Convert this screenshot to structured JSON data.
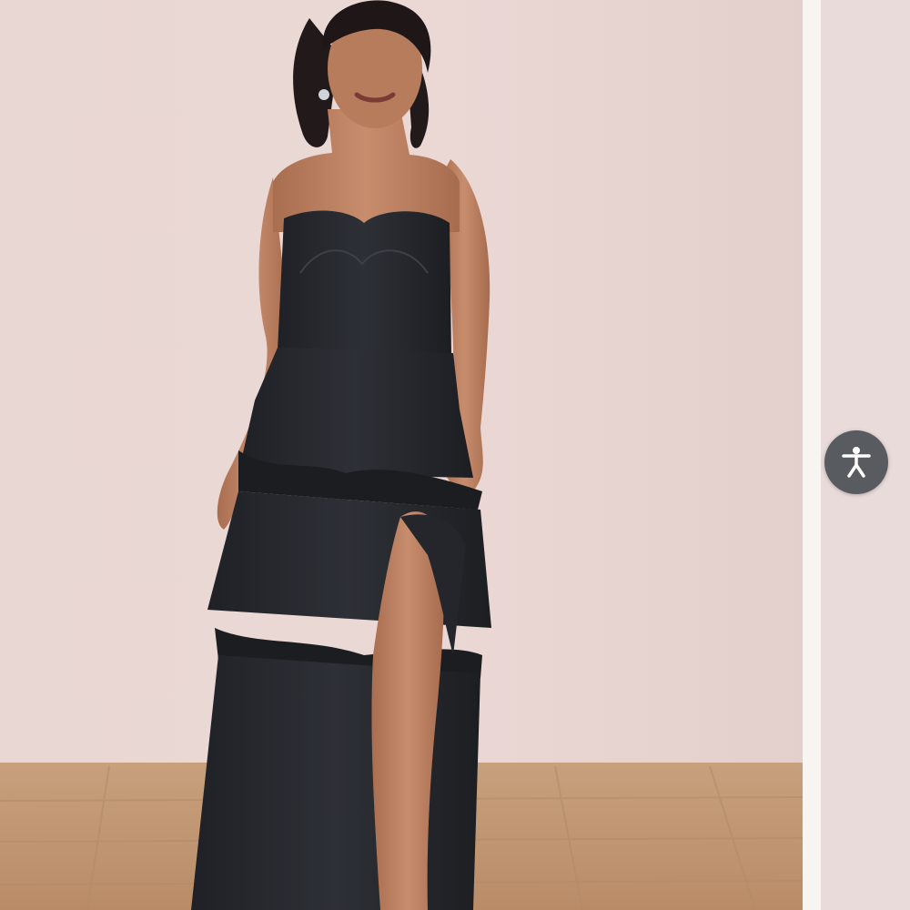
{
  "product_image": {
    "label": ""
  },
  "accessibility_button": {
    "icon": "accessibility-icon",
    "color": "#585b60"
  },
  "colors": {
    "wall": "#e8d5d2",
    "floor": "#c89f7a",
    "dress": "#26282d",
    "skin": "#b97f5f"
  }
}
